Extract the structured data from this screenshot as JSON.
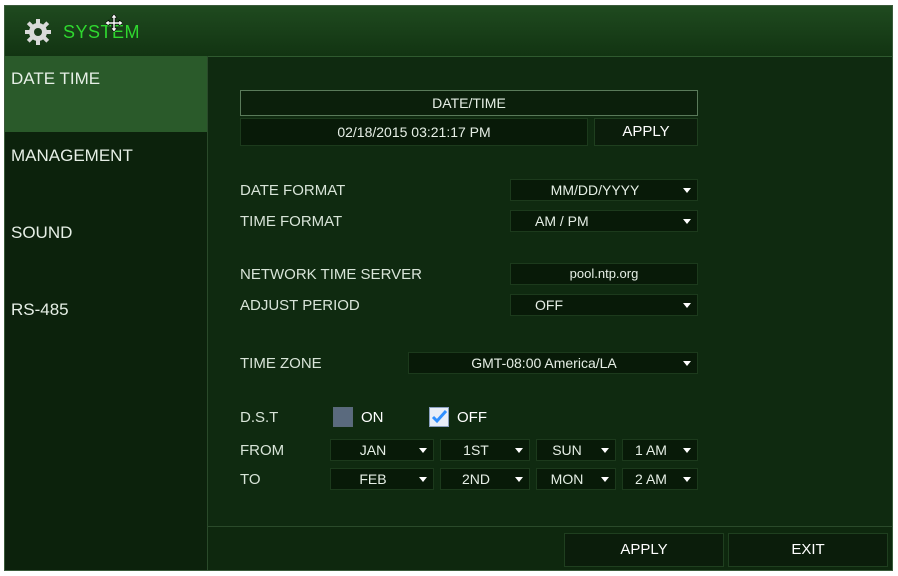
{
  "window": {
    "title": "SYSTEM"
  },
  "sidebar": {
    "items": [
      {
        "label": "DATE TIME"
      },
      {
        "label": "MANAGEMENT"
      },
      {
        "label": "SOUND"
      },
      {
        "label": "RS-485"
      }
    ]
  },
  "datetime": {
    "header": "DATE/TIME",
    "current_value": "02/18/2015 03:21:17 PM",
    "apply_label": "APPLY"
  },
  "date_format": {
    "label": "DATE FORMAT",
    "value": "MM/DD/YYYY"
  },
  "time_format": {
    "label": "TIME FORMAT",
    "value": "AM / PM"
  },
  "ntp": {
    "server_label": "NETWORK TIME SERVER",
    "server_value": "pool.ntp.org",
    "period_label": "ADJUST PERIOD",
    "period_value": "OFF"
  },
  "time_zone": {
    "label": "TIME ZONE",
    "value": "GMT-08:00 America/LA"
  },
  "dst": {
    "label": "D.S.T",
    "on_label": "ON",
    "off_label": "OFF",
    "on_checked": false,
    "off_checked": true,
    "from_label": "FROM",
    "from": {
      "month": "JAN",
      "week": "1ST",
      "day": "SUN",
      "hour": "1 AM"
    },
    "to_label": "TO",
    "to": {
      "month": "FEB",
      "week": "2ND",
      "day": "MON",
      "hour": "2 AM"
    }
  },
  "footer": {
    "apply_label": "APPLY",
    "exit_label": "EXIT"
  },
  "colors": {
    "title_green": "#2fd82f",
    "panel_bg": "#0f2a10",
    "active_item": "#2a5a2a",
    "check_blue": "#2f8fff"
  }
}
